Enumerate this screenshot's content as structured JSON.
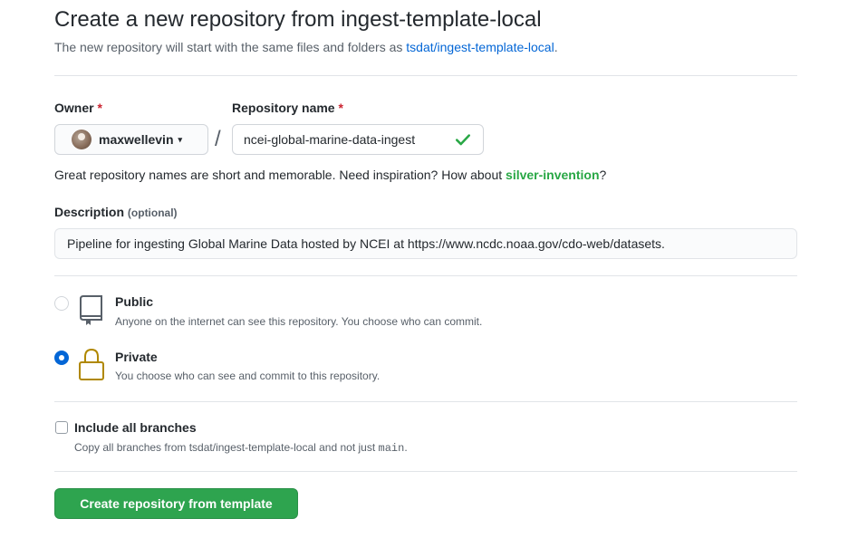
{
  "header": {
    "title": "Create a new repository from ingest-template-local",
    "subtitle_prefix": "The new repository will start with the same files and folders as ",
    "template_link": "tsdat/ingest-template-local",
    "subtitle_suffix": "."
  },
  "owner": {
    "label": "Owner",
    "required_mark": "*",
    "selected": "maxwellevin",
    "caret": "▾"
  },
  "separator": "/",
  "repository": {
    "label": "Repository name",
    "required_mark": "*",
    "value": "ncei-global-marine-data-ingest"
  },
  "hint": {
    "prefix": "Great repository names are short and memorable. Need inspiration? How about ",
    "suggestion": "silver-invention",
    "suffix": "?"
  },
  "description": {
    "label": "Description",
    "optional": "(optional)",
    "value": "Pipeline for ingesting Global Marine Data hosted by NCEI at https://www.ncdc.noaa.gov/cdo-web/datasets."
  },
  "visibility": {
    "selected": "private",
    "options": [
      {
        "id": "public",
        "title": "Public",
        "note": "Anyone on the internet can see this repository. You choose who can commit.",
        "icon": "repo-icon"
      },
      {
        "id": "private",
        "title": "Private",
        "note": "You choose who can see and commit to this repository.",
        "icon": "lock-icon"
      }
    ]
  },
  "branches": {
    "title": "Include all branches",
    "note_prefix": "Copy all branches from tsdat/ingest-template-local and not just ",
    "note_code": "main",
    "note_suffix": ".",
    "checked": false
  },
  "submit_label": "Create repository from template",
  "colors": {
    "link": "#0366d6",
    "success": "#28a745",
    "button": "#2ea44f",
    "required": "#cb2431",
    "lock": "#b08800"
  }
}
